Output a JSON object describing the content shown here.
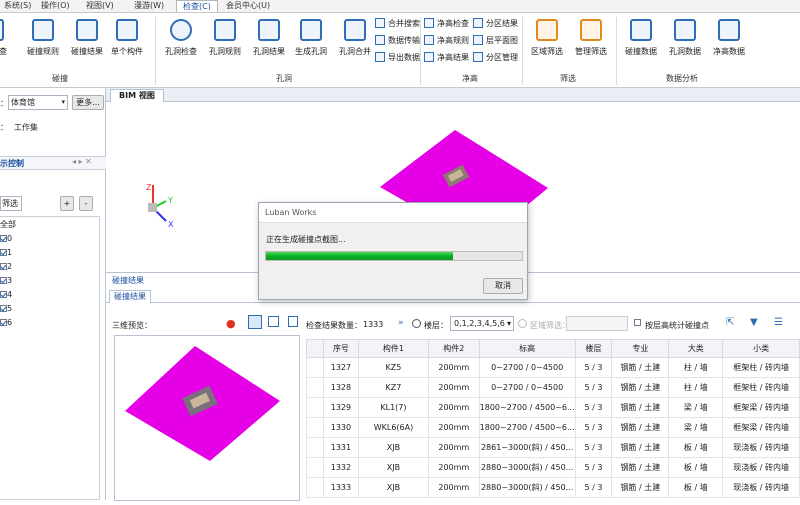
{
  "menu": {
    "items": [
      "系统(S)",
      "操作(O)",
      "视图(V)",
      "漫游(W)",
      "检查(C)",
      "会员中心(U)"
    ],
    "active_index": 4
  },
  "ribbon": {
    "collision_group": {
      "label": "碰撞",
      "btn_partial": "查",
      "btn_rules": "碰撞规则",
      "btn_results": "碰撞结果",
      "btn_single": "单个构件"
    },
    "hole_group": {
      "label": "孔洞",
      "btn_check": "孔洞检查",
      "btn_rules": "孔洞规则",
      "btn_results": "孔洞结果",
      "btn_generate": "生成孔洞",
      "btn_merge": "孔洞合并"
    },
    "small_group1": {
      "merge_search": "合并搜索",
      "data_transfer": "数据传输",
      "export_data": "导出数据"
    },
    "clearance_group": {
      "label": "净高",
      "check": "净高检查",
      "rules": "净高规则",
      "results": "净高结果",
      "zone_results": "分区结果",
      "floor_plan": "层平面图",
      "zone_manage": "分区管理"
    },
    "filter_group": {
      "label": "筛选",
      "zone_filter": "区域筛选",
      "manage_filter": "管理筛选"
    },
    "analysis_group": {
      "label": "数据分析",
      "collision_data": "碰撞数据",
      "hole_data": "孔洞数据",
      "clearance_data": "净高数据"
    }
  },
  "left_pane": {
    "building_label": "：",
    "building_value": "体育馆",
    "more_button": "更多...",
    "workset_label": "工作集",
    "section_title": "示控制",
    "filter_label": "筛选",
    "plus": "+",
    "minus": "-",
    "tree_root": "全部",
    "floors": [
      "0",
      "1",
      "2",
      "3",
      "4",
      "5",
      "6"
    ]
  },
  "view_tab": "BIM 视图",
  "axes": {
    "z": "Z",
    "y": "Y",
    "x": "X"
  },
  "dialog": {
    "title": "Luban Works",
    "message": "正在生成碰撞点截图...",
    "progress": 0.73,
    "cancel": "取消"
  },
  "results_panel": {
    "title": "碰撞结果",
    "tab": "碰撞结果",
    "preview_label": "三维预览：",
    "count_label": "检查结果数量：",
    "count": "1333",
    "floor_label": "楼层：",
    "floor_value": "0,1,2,3,4,5,6",
    "zone_label": "区域筛选：",
    "floor_stat_label": "按层高统计碰撞点"
  },
  "table": {
    "headers": [
      "序号",
      "构件1",
      "构件2",
      "标高",
      "楼层",
      "专业",
      "大类",
      "小类"
    ],
    "rows": [
      [
        "1327",
        "KZ5",
        "200mm",
        "0~2700 / 0~4500",
        "5 / 3",
        "钢筋 / 土建",
        "柱 / 墙",
        "框架柱 / 砖内墙"
      ],
      [
        "1328",
        "KZ7",
        "200mm",
        "0~2700 / 0~4500",
        "5 / 3",
        "钢筋 / 土建",
        "柱 / 墙",
        "框架柱 / 砖内墙"
      ],
      [
        "1329",
        "KL1(7)",
        "200mm",
        "1800~2700 / 4500~6...",
        "5 / 3",
        "钢筋 / 土建",
        "梁 / 墙",
        "框架梁 / 砖内墙"
      ],
      [
        "1330",
        "WKL6(6A)",
        "200mm",
        "1800~2700 / 4500~6...",
        "5 / 3",
        "钢筋 / 土建",
        "梁 / 墙",
        "框架梁 / 砖内墙"
      ],
      [
        "1331",
        "XJB",
        "200mm",
        "2861~3000(斜) / 450...",
        "5 / 3",
        "钢筋 / 土建",
        "板 / 墙",
        "现浇板 / 砖内墙"
      ],
      [
        "1332",
        "XJB",
        "200mm",
        "2880~3000(斜) / 450...",
        "5 / 3",
        "钢筋 / 土建",
        "板 / 墙",
        "现浇板 / 砖内墙"
      ],
      [
        "1333",
        "XJB",
        "200mm",
        "2880~3000(斜) / 450...",
        "5 / 3",
        "钢筋 / 土建",
        "板 / 墙",
        "现浇板 / 砖内墙"
      ]
    ]
  },
  "colors": {
    "magenta": "#e600e6",
    "progress_green": "#06b025",
    "accent_blue": "#2f6db8"
  }
}
